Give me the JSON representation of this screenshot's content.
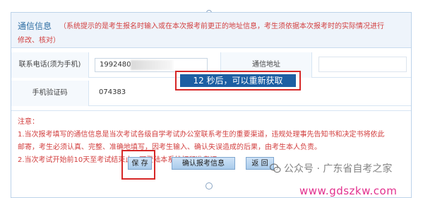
{
  "section": {
    "title": "通信信息",
    "note_line1": "（系统提示的是考生报名时输入或在本次报考前更正的地址信息，考生须依据本次报考时的实际情况进行",
    "note_line2": "修改、核对）"
  },
  "form": {
    "phone_label": "联系电话(须为手机)",
    "phone_value": "1992480",
    "address_label": "通信地址",
    "address_value": "",
    "code_label": "手机验证码",
    "code_value": "074383",
    "countdown_text": "12 秒后，可以重新获取"
  },
  "notes": {
    "title": "注意：",
    "line1": "1.当次报考填写的通信信息是当次考试各级自学考试办公室联系考生的重要渠道，违规处理事先告知书和决定书将依此",
    "line2": "邮寄，考生必须认真、完整、准确地填写，因考生输入、确认失误造成的后果，由考生本人负责。",
    "line3": "2.当次考试开始前10天至考试结束止，可登陆本系统打印准考证。"
  },
  "actions": {
    "save_label": "保 存",
    "confirm_label": "确认报考信息",
    "return_label": "返 回"
  },
  "watermark": {
    "account_text": "公众号 · 广东省自考之家",
    "url_text": "www.gdszkw.com"
  },
  "colors": {
    "accent_blue": "#1d5fa3",
    "warning_red": "#d23f3f",
    "highlight_red": "#d62828",
    "url_pink": "#e2308e"
  },
  "icons": [
    "wechat-icon"
  ]
}
